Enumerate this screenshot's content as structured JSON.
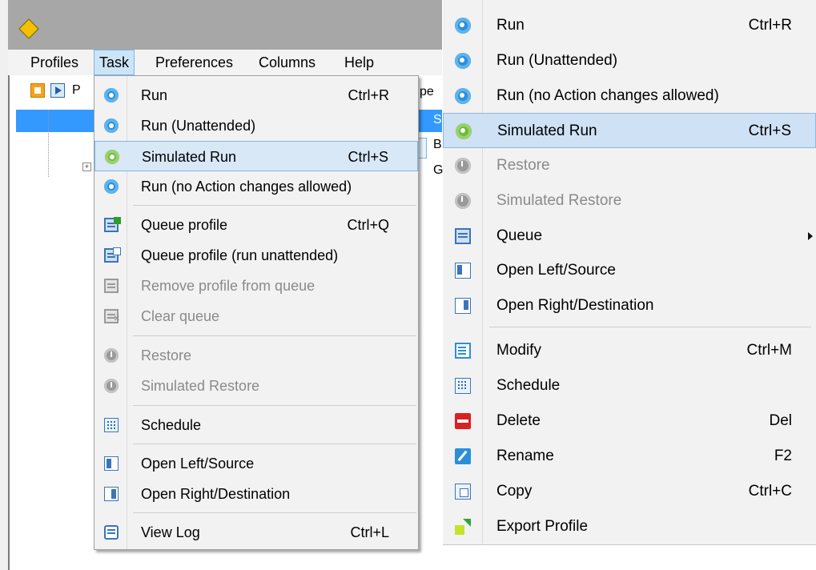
{
  "menubar": {
    "items": [
      "Profiles",
      "Task",
      "Preferences",
      "Columns",
      "Help"
    ]
  },
  "tree": {
    "toolbar_letter": "P",
    "col_header_fragment": "pe",
    "row_fragments": [
      "S",
      "B",
      "G"
    ]
  },
  "task_menu": {
    "items": [
      {
        "label": "Run",
        "shortcut": "Ctrl+R",
        "icon": "gear-icon",
        "enabled": true
      },
      {
        "label": "Run (Unattended)",
        "shortcut": "",
        "icon": "gear-icon",
        "enabled": true
      },
      {
        "label": "Simulated Run",
        "shortcut": "Ctrl+S",
        "icon": "gear-green-icon",
        "enabled": true,
        "highlighted": true
      },
      {
        "label": "Run (no Action changes allowed)",
        "shortcut": "",
        "icon": "gear-icon",
        "enabled": true
      },
      {
        "label": "Queue profile",
        "shortcut": "Ctrl+Q",
        "icon": "queue-add-icon",
        "enabled": true
      },
      {
        "label": "Queue profile (run unattended)",
        "shortcut": "",
        "icon": "queue-add-unattended-icon",
        "enabled": true
      },
      {
        "label": "Remove profile from queue",
        "shortcut": "",
        "icon": "queue-remove-icon",
        "enabled": false
      },
      {
        "label": "Clear queue",
        "shortcut": "",
        "icon": "queue-clear-icon",
        "enabled": false
      },
      {
        "label": "Restore",
        "shortcut": "",
        "icon": "clock-icon",
        "enabled": false
      },
      {
        "label": "Simulated Restore",
        "shortcut": "",
        "icon": "clock-icon",
        "enabled": false
      },
      {
        "label": "Schedule",
        "shortcut": "",
        "icon": "schedule-icon",
        "enabled": true
      },
      {
        "label": "Open Left/Source",
        "shortcut": "",
        "icon": "left-source-icon",
        "enabled": true
      },
      {
        "label": "Open Right/Destination",
        "shortcut": "",
        "icon": "right-destination-icon",
        "enabled": true
      },
      {
        "label": "View Log",
        "shortcut": "Ctrl+L",
        "icon": "log-icon",
        "enabled": true
      }
    ]
  },
  "context_menu": {
    "items": [
      {
        "label": "Run",
        "shortcut": "Ctrl+R",
        "icon": "gear-icon",
        "enabled": true
      },
      {
        "label": "Run (Unattended)",
        "shortcut": "",
        "icon": "gear-icon",
        "enabled": true
      },
      {
        "label": "Run (no Action changes allowed)",
        "shortcut": "",
        "icon": "gear-icon",
        "enabled": true
      },
      {
        "label": "Simulated Run",
        "shortcut": "Ctrl+S",
        "icon": "gear-green-icon",
        "enabled": true,
        "highlighted": true
      },
      {
        "label": "Restore",
        "shortcut": "",
        "icon": "clock-icon",
        "enabled": false
      },
      {
        "label": "Simulated Restore",
        "shortcut": "",
        "icon": "clock-icon",
        "enabled": false
      },
      {
        "label": "Queue",
        "shortcut": "",
        "icon": "queue-icon",
        "enabled": true,
        "submenu": true
      },
      {
        "label": "Open Left/Source",
        "shortcut": "",
        "icon": "left-source-icon",
        "enabled": true
      },
      {
        "label": "Open Right/Destination",
        "shortcut": "",
        "icon": "right-destination-icon",
        "enabled": true
      },
      {
        "label": "Modify",
        "shortcut": "Ctrl+M",
        "icon": "modify-icon",
        "enabled": true
      },
      {
        "label": "Schedule",
        "shortcut": "",
        "icon": "schedule-icon",
        "enabled": true
      },
      {
        "label": "Delete",
        "shortcut": "Del",
        "icon": "delete-icon",
        "enabled": true
      },
      {
        "label": "Rename",
        "shortcut": "F2",
        "icon": "rename-icon",
        "enabled": true
      },
      {
        "label": "Copy",
        "shortcut": "Ctrl+C",
        "icon": "copy-icon",
        "enabled": true
      },
      {
        "label": "Export Profile",
        "shortcut": "",
        "icon": "export-icon",
        "enabled": true
      }
    ]
  },
  "colors": {
    "highlight": "#cfe1f4",
    "selection": "#3399ff",
    "disabled_text": "#8a8a8a"
  }
}
